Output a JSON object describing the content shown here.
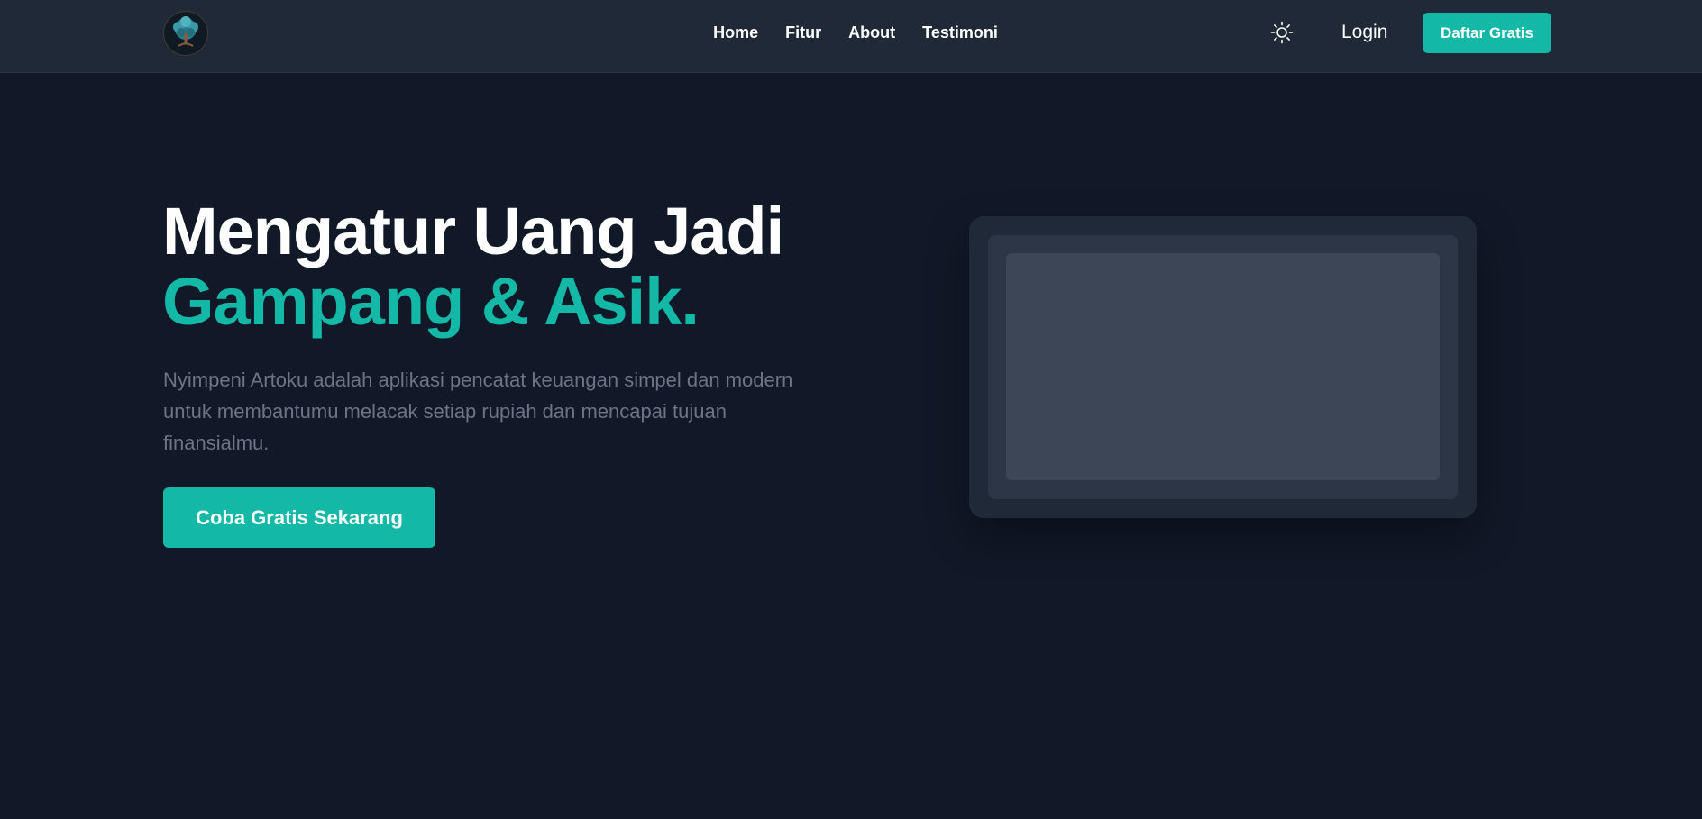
{
  "nav": {
    "logo_icon": "tree-logo-icon",
    "links": [
      {
        "label": "Home"
      },
      {
        "label": "Fitur"
      },
      {
        "label": "About"
      },
      {
        "label": "Testimoni"
      }
    ],
    "theme_icon": "sun-icon",
    "login_label": "Login",
    "signup_label": "Daftar Gratis"
  },
  "hero": {
    "title_line1": "Mengatur Uang Jadi",
    "title_line2": "Gampang & Asik.",
    "description": "Nyimpeni Artoku adalah aplikasi pencatat keuangan simpel dan modern untuk membantumu melacak setiap rupiah dan mencapai tujuan finansialmu.",
    "cta_label": "Coba Gratis Sekarang"
  },
  "colors": {
    "background": "#111827",
    "navbar": "#1f2937",
    "accent": "#14b8a6",
    "muted_text": "#6b7585"
  }
}
